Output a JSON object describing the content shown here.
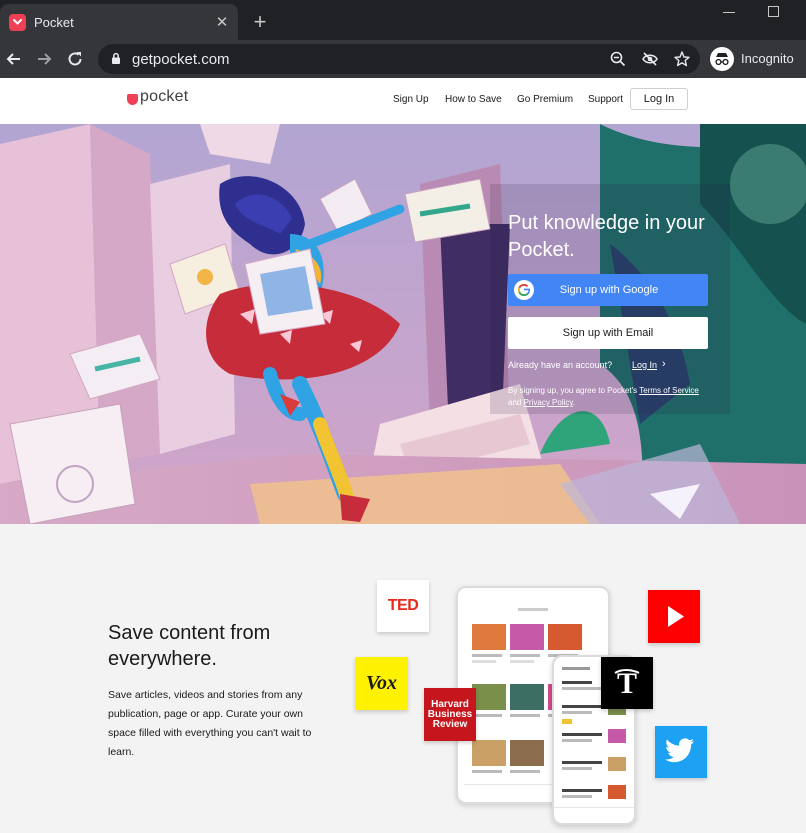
{
  "browser": {
    "tab_title": "Pocket",
    "tab_close": "✕",
    "new_tab": "+",
    "url": "getpocket.com",
    "profile_label": "Incognito"
  },
  "header": {
    "logo_text": "pocket",
    "nav": [
      "Sign Up",
      "How to Save",
      "Go Premium",
      "Support"
    ],
    "login_label": "Log In"
  },
  "hero": {
    "title": "Put knowledge in your Pocket.",
    "google_button": "Sign up with Google",
    "email_button": "Sign up with Email",
    "already_text": "Already have an account?",
    "login_link": "Log In",
    "terms_prefix": "By signing up, you agree to Pocket's",
    "terms_link": "Terms of Service",
    "terms_and": "and",
    "privacy_link": "Privacy Policy",
    "terms_suffix": "."
  },
  "save_section": {
    "title": "Save content from everywhere.",
    "description": "Save articles, videos and stories from any publication, page or app. Curate your own space filled with everything you can't wait to learn.",
    "logos": {
      "ted": "TED",
      "vox": "Vox",
      "hbr": "Harvard Business Review"
    }
  },
  "colors": {
    "pocket_red": "#ef4056",
    "google_blue": "#4285f4",
    "chrome_dark": "#202124",
    "chrome_toolbar": "#35363a"
  },
  "icons": [
    "pocket-favicon",
    "back-arrow-icon",
    "forward-arrow-icon",
    "reload-icon",
    "lock-icon",
    "zoom-out-icon",
    "eye-off-icon",
    "star-icon",
    "incognito-icon",
    "google-g-icon",
    "chevron-right-icon",
    "youtube-play-icon",
    "nyt-logo-icon",
    "twitter-bird-icon"
  ]
}
